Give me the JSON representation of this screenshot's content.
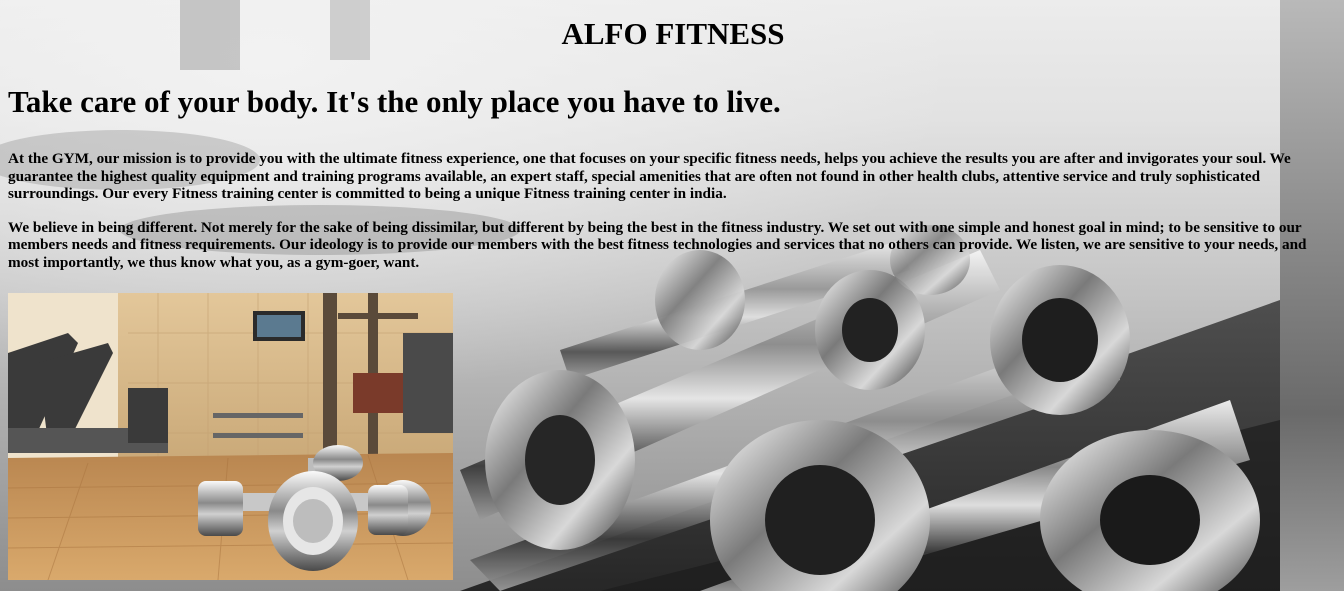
{
  "header": {
    "brand": "ALFO FITNESS",
    "tagline": "Take care of your body. It's the only place you have to live."
  },
  "main": {
    "paragraphs": [
      "At the GYM, our mission is to provide you with the ultimate fitness experience, one that focuses on your specific fitness needs, helps you achieve the results you are after and invigorates your soul. We guarantee the highest quality equipment and training programs available, an expert staff, special amenities that are often not found in other health clubs, attentive service and truly sophisticated surroundings. Our every Fitness training center is committed to being a unique Fitness training center in india.",
      "We believe in being different. Not merely for the sake of being dissimilar, but different by being the best in the fitness industry. We set out with one simple and honest goal in mind; to be sensitive to our members needs and fitness requirements. Our ideology is to provide our members with the best fitness technologies and services that no others can provide. We listen, we are sensitive to your needs, and most importantly, we thus know what you, as a gym-goer, want."
    ]
  },
  "images": {
    "background": "dumbbell-rack-photo",
    "gym_photo": "gym-floor-dumbbells-photo"
  },
  "colors": {
    "text": "#000000",
    "floor": "#c8925a",
    "wall": "#d9b98a"
  }
}
